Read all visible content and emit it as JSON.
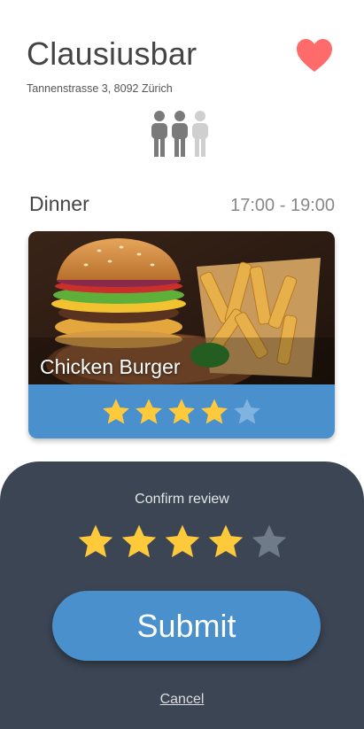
{
  "restaurant": {
    "name": "Clausiusbar",
    "address": "Tannenstrasse 3, 8092 Zürich",
    "favorite": true
  },
  "party": {
    "active_people": 2,
    "total_people": 3
  },
  "meal": {
    "type": "Dinner",
    "time": "17:00 - 19:00",
    "dish_name": "Chicken Burger",
    "rating": 4,
    "max_rating": 5
  },
  "review": {
    "confirm_label": "Confirm review",
    "rating": 4,
    "max_rating": 5,
    "submit_label": "Submit",
    "cancel_label": "Cancel"
  },
  "colors": {
    "accent_blue": "#4a90cc",
    "star_filled": "#ffc93c",
    "heart": "#ff6b6b",
    "sheet_bg": "#3b4554"
  }
}
